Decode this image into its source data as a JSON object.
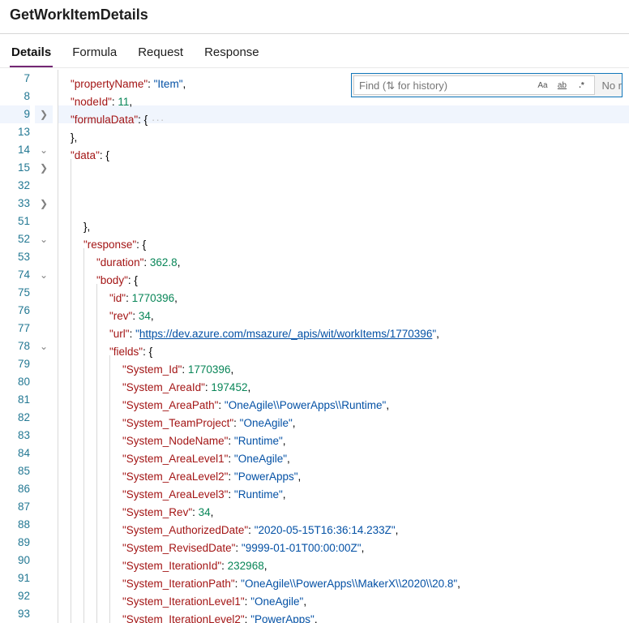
{
  "title": "GetWorkItemDetails",
  "tabs": [
    "Details",
    "Formula",
    "Request",
    "Response"
  ],
  "activeTab": "Details",
  "find": {
    "placeholder": "Find (⇅ for history)",
    "btnCase": "Aa",
    "btnWord": "ab",
    "btnRegex": ".*",
    "noResults": "No r"
  },
  "lines": [
    {
      "num": "7",
      "fold": "",
      "indent": 1,
      "segs": [
        {
          "t": "\"propertyName\"",
          "c": "k"
        },
        {
          "t": ": ",
          "c": "p"
        },
        {
          "t": "\"Item\"",
          "c": "s"
        },
        {
          "t": ",",
          "c": "p"
        }
      ]
    },
    {
      "num": "8",
      "fold": "",
      "indent": 1,
      "segs": [
        {
          "t": "\"nodeId\"",
          "c": "k"
        },
        {
          "t": ": ",
          "c": "p"
        },
        {
          "t": "11",
          "c": "n"
        },
        {
          "t": ",",
          "c": "p"
        }
      ]
    },
    {
      "num": "9",
      "fold": ">",
      "indent": 1,
      "hl": true,
      "segs": [
        {
          "t": "\"formulaData\"",
          "c": "k"
        },
        {
          "t": ": {",
          "c": "p"
        },
        {
          "t": " ···",
          "c": "coll"
        }
      ]
    },
    {
      "num": "13",
      "fold": "",
      "indent": 1,
      "segs": [
        {
          "t": "},",
          "c": "p"
        }
      ]
    },
    {
      "num": "14",
      "fold": "v",
      "indent": 1,
      "segs": [
        {
          "t": "\"data\"",
          "c": "k"
        },
        {
          "t": ": {",
          "c": "p"
        }
      ]
    },
    {
      "num": "15",
      "fold": ">",
      "indent": 2,
      "segs": []
    },
    {
      "num": "32",
      "fold": "",
      "indent": 2,
      "segs": []
    },
    {
      "num": "33",
      "fold": ">",
      "indent": 2,
      "segs": []
    },
    {
      "num": "51",
      "fold": "",
      "indent": 2,
      "segs": [
        {
          "t": "},",
          "c": "p"
        }
      ]
    },
    {
      "num": "52",
      "fold": "v",
      "indent": 2,
      "segs": [
        {
          "t": "\"response\"",
          "c": "k"
        },
        {
          "t": ": {",
          "c": "p"
        }
      ]
    },
    {
      "num": "53",
      "fold": "",
      "indent": 3,
      "segs": [
        {
          "t": "\"duration\"",
          "c": "k"
        },
        {
          "t": ": ",
          "c": "p"
        },
        {
          "t": "362.8",
          "c": "n"
        },
        {
          "t": ",",
          "c": "p"
        }
      ]
    },
    {
      "num": "74",
      "fold": "v",
      "indent": 3,
      "segs": [
        {
          "t": "\"body\"",
          "c": "k"
        },
        {
          "t": ": {",
          "c": "p"
        }
      ]
    },
    {
      "num": "75",
      "fold": "",
      "indent": 4,
      "segs": [
        {
          "t": "\"id\"",
          "c": "k"
        },
        {
          "t": ": ",
          "c": "p"
        },
        {
          "t": "1770396",
          "c": "n"
        },
        {
          "t": ",",
          "c": "p"
        }
      ]
    },
    {
      "num": "76",
      "fold": "",
      "indent": 4,
      "segs": [
        {
          "t": "\"rev\"",
          "c": "k"
        },
        {
          "t": ": ",
          "c": "p"
        },
        {
          "t": "34",
          "c": "n"
        },
        {
          "t": ",",
          "c": "p"
        }
      ]
    },
    {
      "num": "77",
      "fold": "",
      "indent": 4,
      "segs": [
        {
          "t": "\"url\"",
          "c": "k"
        },
        {
          "t": ": ",
          "c": "p"
        },
        {
          "t": "\"",
          "c": "s"
        },
        {
          "t": "https://dev.azure.com/msazure/_apis/wit/workItems/1770396",
          "c": "url"
        },
        {
          "t": "\"",
          "c": "s"
        },
        {
          "t": ",",
          "c": "p"
        }
      ]
    },
    {
      "num": "78",
      "fold": "v",
      "indent": 4,
      "segs": [
        {
          "t": "\"fields\"",
          "c": "k"
        },
        {
          "t": ": {",
          "c": "p"
        }
      ]
    },
    {
      "num": "79",
      "fold": "",
      "indent": 5,
      "segs": [
        {
          "t": "\"System_Id\"",
          "c": "k"
        },
        {
          "t": ": ",
          "c": "p"
        },
        {
          "t": "1770396",
          "c": "n"
        },
        {
          "t": ",",
          "c": "p"
        }
      ]
    },
    {
      "num": "80",
      "fold": "",
      "indent": 5,
      "segs": [
        {
          "t": "\"System_AreaId\"",
          "c": "k"
        },
        {
          "t": ": ",
          "c": "p"
        },
        {
          "t": "197452",
          "c": "n"
        },
        {
          "t": ",",
          "c": "p"
        }
      ]
    },
    {
      "num": "81",
      "fold": "",
      "indent": 5,
      "segs": [
        {
          "t": "\"System_AreaPath\"",
          "c": "k"
        },
        {
          "t": ": ",
          "c": "p"
        },
        {
          "t": "\"OneAgile\\\\PowerApps\\\\Runtime\"",
          "c": "s"
        },
        {
          "t": ",",
          "c": "p"
        }
      ]
    },
    {
      "num": "82",
      "fold": "",
      "indent": 5,
      "segs": [
        {
          "t": "\"System_TeamProject\"",
          "c": "k"
        },
        {
          "t": ": ",
          "c": "p"
        },
        {
          "t": "\"OneAgile\"",
          "c": "s"
        },
        {
          "t": ",",
          "c": "p"
        }
      ]
    },
    {
      "num": "83",
      "fold": "",
      "indent": 5,
      "segs": [
        {
          "t": "\"System_NodeName\"",
          "c": "k"
        },
        {
          "t": ": ",
          "c": "p"
        },
        {
          "t": "\"Runtime\"",
          "c": "s"
        },
        {
          "t": ",",
          "c": "p"
        }
      ]
    },
    {
      "num": "84",
      "fold": "",
      "indent": 5,
      "segs": [
        {
          "t": "\"System_AreaLevel1\"",
          "c": "k"
        },
        {
          "t": ": ",
          "c": "p"
        },
        {
          "t": "\"OneAgile\"",
          "c": "s"
        },
        {
          "t": ",",
          "c": "p"
        }
      ]
    },
    {
      "num": "85",
      "fold": "",
      "indent": 5,
      "segs": [
        {
          "t": "\"System_AreaLevel2\"",
          "c": "k"
        },
        {
          "t": ": ",
          "c": "p"
        },
        {
          "t": "\"PowerApps\"",
          "c": "s"
        },
        {
          "t": ",",
          "c": "p"
        }
      ]
    },
    {
      "num": "86",
      "fold": "",
      "indent": 5,
      "segs": [
        {
          "t": "\"System_AreaLevel3\"",
          "c": "k"
        },
        {
          "t": ": ",
          "c": "p"
        },
        {
          "t": "\"Runtime\"",
          "c": "s"
        },
        {
          "t": ",",
          "c": "p"
        }
      ]
    },
    {
      "num": "87",
      "fold": "",
      "indent": 5,
      "segs": [
        {
          "t": "\"System_Rev\"",
          "c": "k"
        },
        {
          "t": ": ",
          "c": "p"
        },
        {
          "t": "34",
          "c": "n"
        },
        {
          "t": ",",
          "c": "p"
        }
      ]
    },
    {
      "num": "88",
      "fold": "",
      "indent": 5,
      "segs": [
        {
          "t": "\"System_AuthorizedDate\"",
          "c": "k"
        },
        {
          "t": ": ",
          "c": "p"
        },
        {
          "t": "\"2020-05-15T16:36:14.233Z\"",
          "c": "s"
        },
        {
          "t": ",",
          "c": "p"
        }
      ]
    },
    {
      "num": "89",
      "fold": "",
      "indent": 5,
      "segs": [
        {
          "t": "\"System_RevisedDate\"",
          "c": "k"
        },
        {
          "t": ": ",
          "c": "p"
        },
        {
          "t": "\"9999-01-01T00:00:00Z\"",
          "c": "s"
        },
        {
          "t": ",",
          "c": "p"
        }
      ]
    },
    {
      "num": "90",
      "fold": "",
      "indent": 5,
      "segs": [
        {
          "t": "\"System_IterationId\"",
          "c": "k"
        },
        {
          "t": ": ",
          "c": "p"
        },
        {
          "t": "232968",
          "c": "n"
        },
        {
          "t": ",",
          "c": "p"
        }
      ]
    },
    {
      "num": "91",
      "fold": "",
      "indent": 5,
      "segs": [
        {
          "t": "\"System_IterationPath\"",
          "c": "k"
        },
        {
          "t": ": ",
          "c": "p"
        },
        {
          "t": "\"OneAgile\\\\PowerApps\\\\MakerX\\\\2020\\\\20.8\"",
          "c": "s"
        },
        {
          "t": ",",
          "c": "p"
        }
      ]
    },
    {
      "num": "92",
      "fold": "",
      "indent": 5,
      "segs": [
        {
          "t": "\"System_IterationLevel1\"",
          "c": "k"
        },
        {
          "t": ": ",
          "c": "p"
        },
        {
          "t": "\"OneAgile\"",
          "c": "s"
        },
        {
          "t": ",",
          "c": "p"
        }
      ]
    },
    {
      "num": "93",
      "fold": "",
      "indent": 5,
      "segs": [
        {
          "t": "\"System_IterationLevel2\"",
          "c": "k"
        },
        {
          "t": ": ",
          "c": "p"
        },
        {
          "t": "\"PowerApps\"",
          "c": "s"
        },
        {
          "t": ",",
          "c": "p"
        }
      ]
    }
  ]
}
